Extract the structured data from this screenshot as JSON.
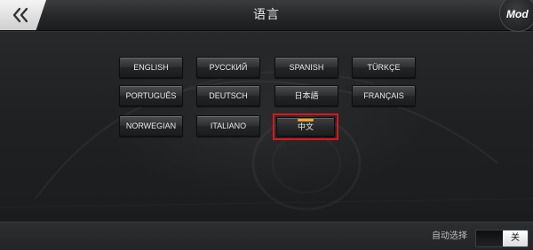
{
  "header": {
    "title": "语言",
    "back_icon": "double-chevron-left-icon",
    "mod_badge": "Mod"
  },
  "languages": {
    "items": [
      {
        "label": "ENGLISH",
        "selected": false
      },
      {
        "label": "РУССКИЙ",
        "selected": false
      },
      {
        "label": "SPANISH",
        "selected": false
      },
      {
        "label": "TÜRKÇE",
        "selected": false
      },
      {
        "label": "PORTUGUÊS",
        "selected": false
      },
      {
        "label": "DEUTSCH",
        "selected": false
      },
      {
        "label": "日本語",
        "selected": false
      },
      {
        "label": "FRANÇAIS",
        "selected": false
      },
      {
        "label": "NORWEGIAN",
        "selected": false
      },
      {
        "label": "ITALIANO",
        "selected": false
      },
      {
        "label": "中文",
        "selected": true
      }
    ]
  },
  "footer": {
    "auto_select_label": "自动选择",
    "toggle_state_label": "关",
    "toggle_on": false
  },
  "colors": {
    "highlight": "#e0151b",
    "selected_indicator": "#f2a51c",
    "background": "#1f2123"
  }
}
